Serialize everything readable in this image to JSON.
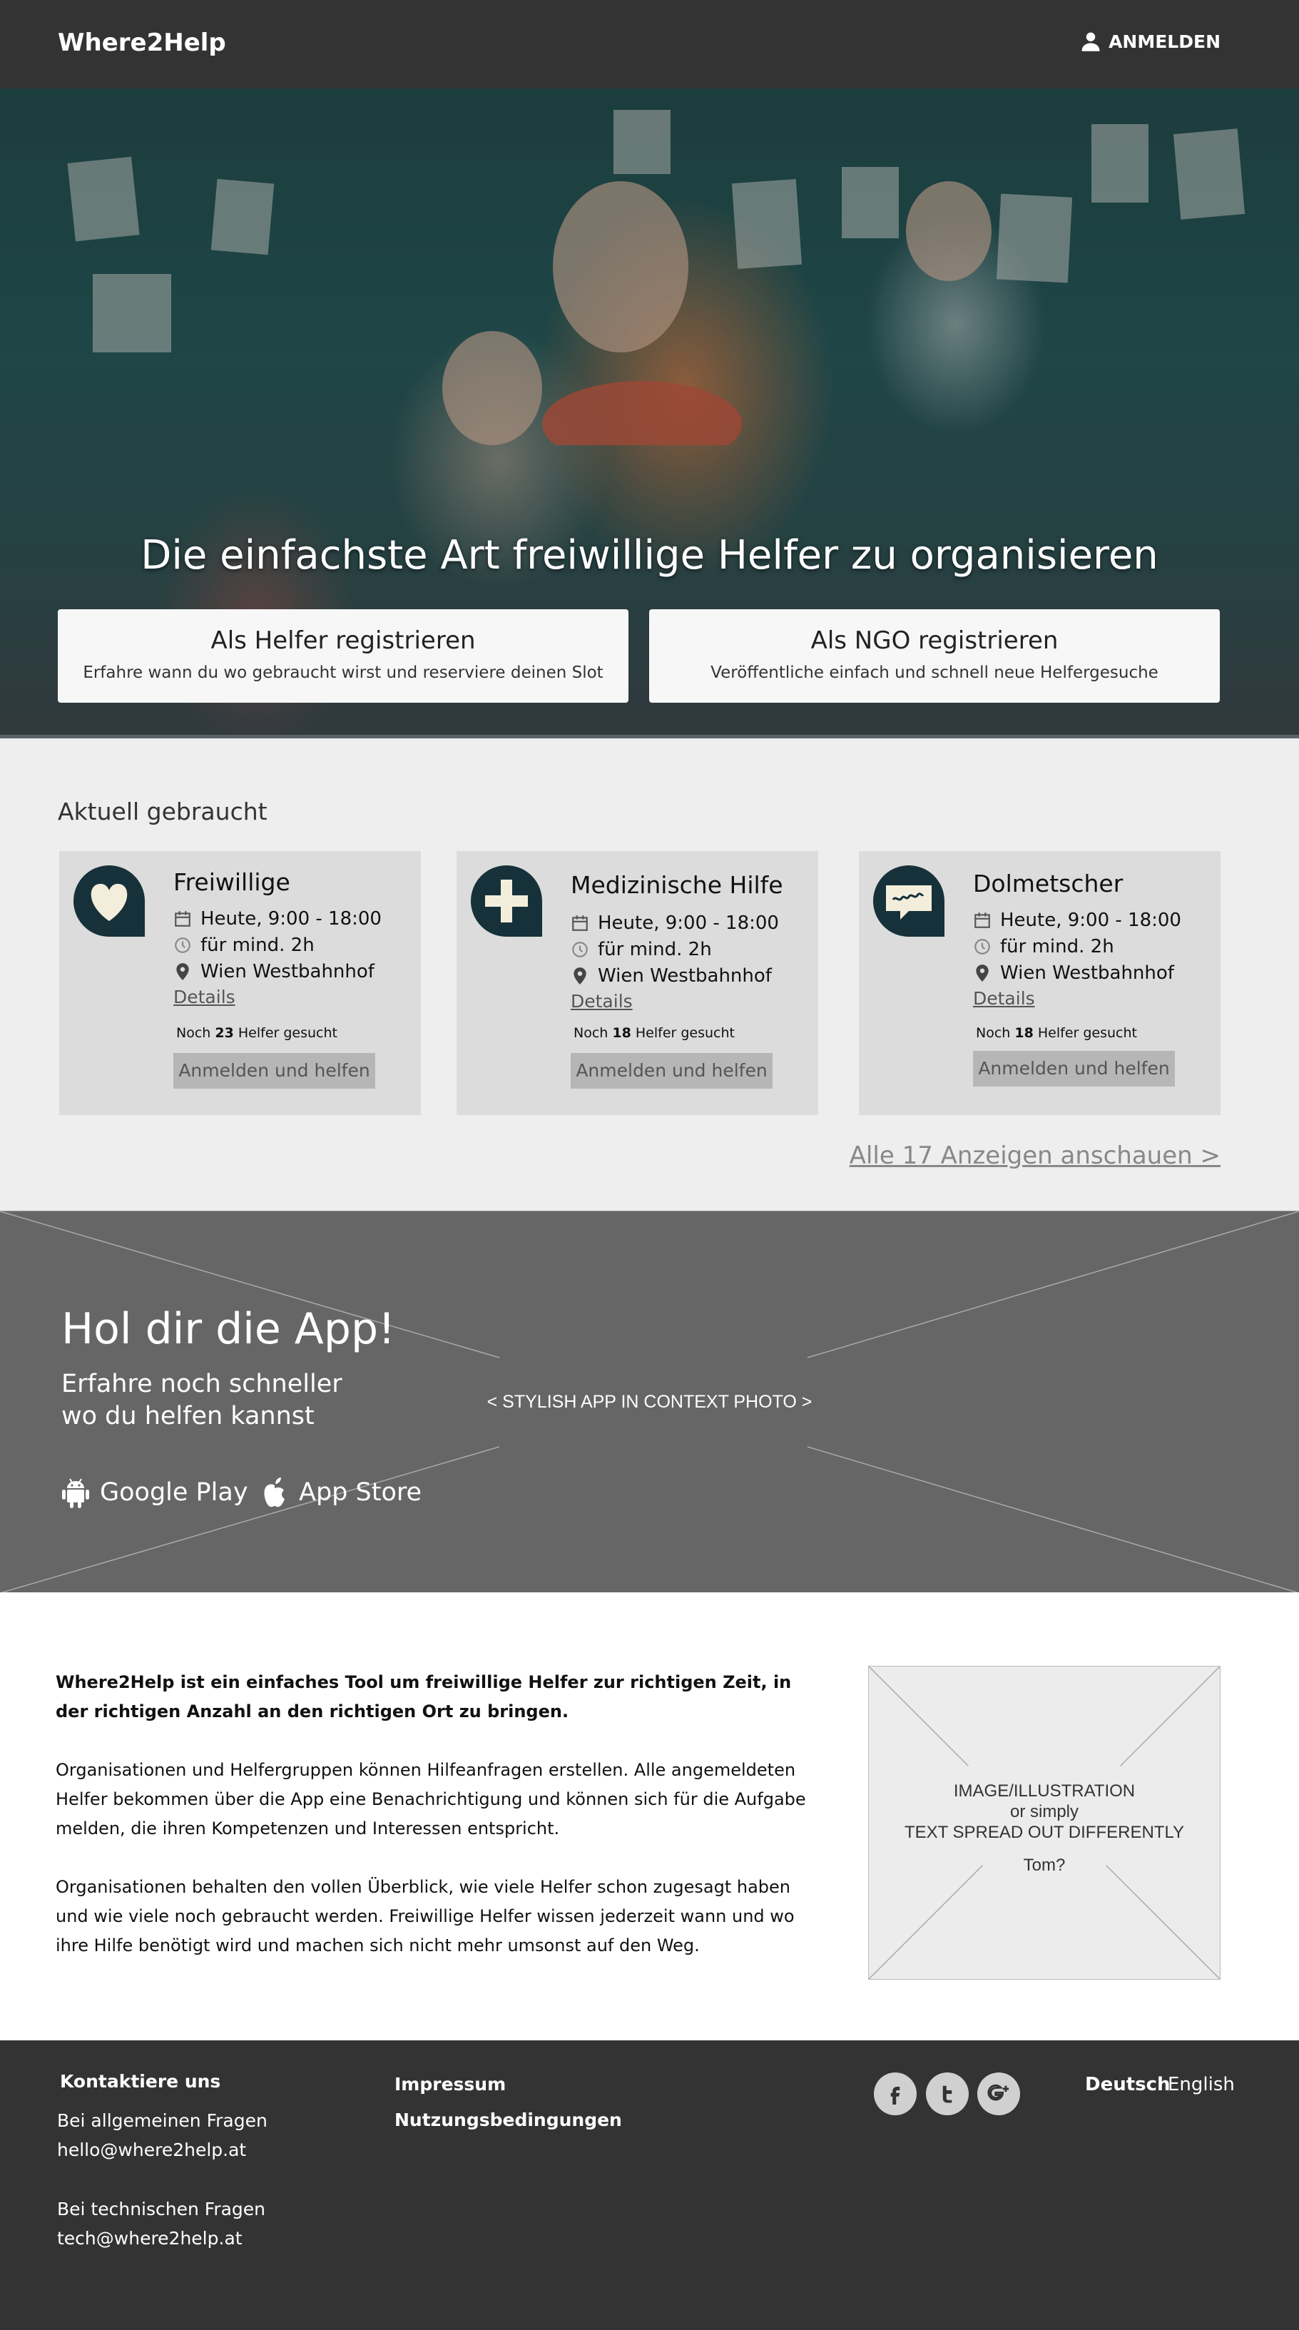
{
  "header": {
    "logo": "Where2Help",
    "login_label": "ANMELDEN"
  },
  "hero": {
    "title": "Die einfachste Art freiwillige Helfer zu organisieren",
    "helper_card": {
      "title": "Als Helfer registrieren",
      "subtitle": "Erfahre wann du wo gebraucht wirst und reserviere deinen Slot"
    },
    "ngo_card": {
      "title": "Als NGO registrieren",
      "subtitle": "Veröffentliche einfach und schnell neue Helfergesuche"
    }
  },
  "needed": {
    "title": "Aktuell gebraucht",
    "cards": [
      {
        "name": "Freiwillige",
        "time": "Heute, 9:00 - 18:00",
        "duration": "für mind. 2h",
        "location": "Wien Westbahnhof",
        "details": "Details",
        "count_prefix": "Noch",
        "count": "23",
        "count_suffix": "Helfer gesucht",
        "button": "Anmelden und helfen",
        "icon": "heart-icon"
      },
      {
        "name": "Medizinische Hilfe",
        "time": "Heute, 9:00 - 18:00",
        "duration": "für mind. 2h",
        "location": "Wien Westbahnhof",
        "details": "Details",
        "count_prefix": "Noch",
        "count": "18",
        "count_suffix": "Helfer gesucht",
        "button": "Anmelden und helfen",
        "icon": "medical-cross-icon"
      },
      {
        "name": "Dolmetscher",
        "time": "Heute, 9:00 - 18:00",
        "duration": "für mind. 2h",
        "location": "Wien Westbahnhof",
        "details": "Details",
        "count_prefix": "Noch",
        "count": "18",
        "count_suffix": "Helfer gesucht",
        "button": "Anmelden und helfen",
        "icon": "speech-bubble-icon"
      }
    ],
    "all_link": "Alle 17 Anzeigen anschauen >"
  },
  "app": {
    "title": "Hol dir die App!",
    "subtitle_line1": "Erfahre noch schneller",
    "subtitle_line2": "wo du helfen kannst",
    "placeholder": "< STYLISH APP IN CONTEXT PHOTO >",
    "google_play": "Google Play",
    "app_store": "App Store"
  },
  "about": {
    "lead": "Where2Help ist ein einfaches Tool um freiwillige Helfer zur richtigen Zeit, in der richtigen Anzahl an den richtigen Ort zu bringen.",
    "p1": "Organisationen und Helfergruppen können Hilfeanfragen erstellen. Alle angemeldeten Helfer bekommen über die App eine Benachrichtigung und können sich für die Aufgabe melden, die ihren Kompetenzen und Interessen entspricht.",
    "p2": "Organisationen behalten den vollen Überblick, wie viele Helfer schon zugesagt haben und wie viele noch gebraucht werden. Freiwillige Helfer wissen jederzeit wann und wo ihre Hilfe benötigt wird und machen sich nicht mehr umsonst auf den Weg.",
    "illus_line1": "IMAGE/ILLUSTRATION",
    "illus_line2": "or simply",
    "illus_line3": "TEXT SPREAD OUT DIFFERENTLY",
    "illus_tom": "Tom?"
  },
  "footer": {
    "contact_title": "Kontaktiere uns",
    "general_label": "Bei allgemeinen Fragen",
    "general_email": "hello@where2help.at",
    "tech_label": "Bei technischen Fragen",
    "tech_email": "tech@where2help.at",
    "impressum": "Impressum",
    "terms": "Nutzungsbedingungen",
    "lang_de": "Deutsch",
    "lang_en": "English"
  },
  "colors": {
    "header_bg": "#333333",
    "footer_bg": "#333333",
    "section_bg": "#eeeeee",
    "card_bg": "#dcdcdc",
    "badge_bg": "#16313a",
    "badge_fg": "#f3eedb",
    "app_bg": "#666666"
  }
}
